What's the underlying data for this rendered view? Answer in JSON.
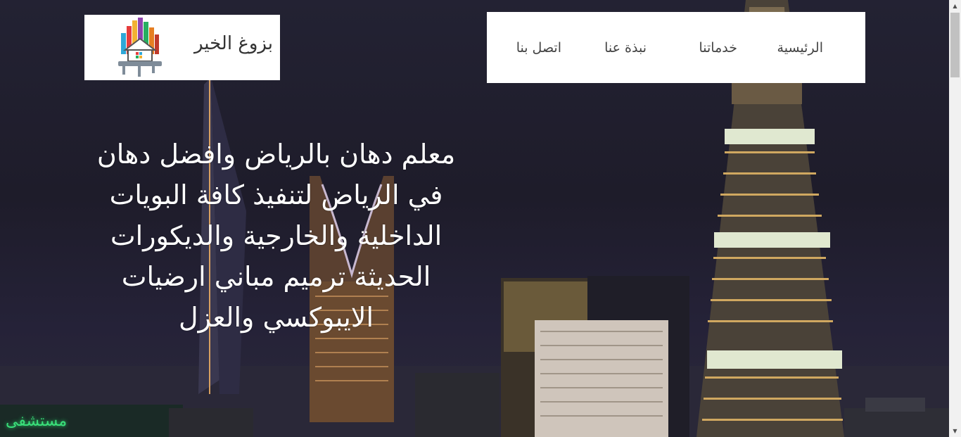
{
  "brand": {
    "name": "بزوغ الخير",
    "logo_icon": "paint-roller-house-icon"
  },
  "nav": {
    "items": [
      {
        "label": "الرئيسية"
      },
      {
        "label": "خدماتنا"
      },
      {
        "label": "نبذة عنا"
      },
      {
        "label": "اتصل بنا"
      }
    ]
  },
  "hero": {
    "headline": "معلم دهان بالرياض وافضل دهان في الرياض لتنفيذ كافة البويات الداخلية والخارجية والديكورات الحديثة ترميم مباني ارضيات الايبوكسي والعزل",
    "background": "riyadh-night-skyline",
    "sign_text": "مستشفى"
  },
  "colors": {
    "nav_bg": "#ffffff",
    "text_dark": "#444444",
    "headline": "#ffffff",
    "sky": "#1f1d2c"
  }
}
